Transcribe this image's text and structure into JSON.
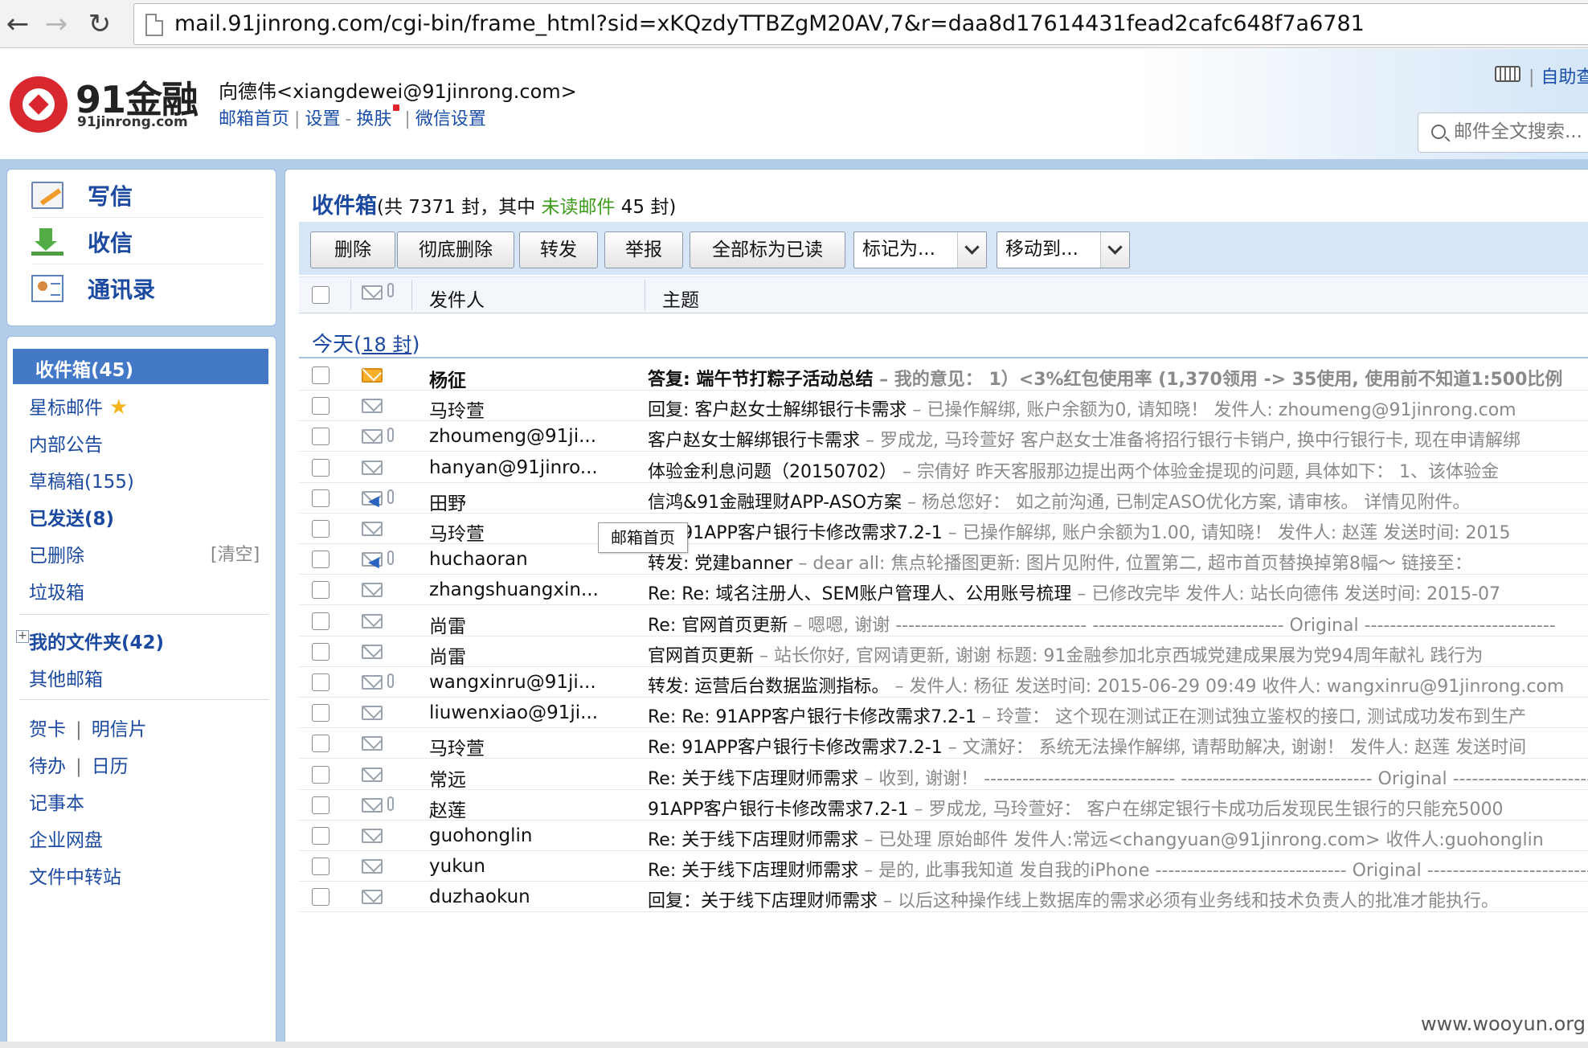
{
  "browser": {
    "back_glyph": "←",
    "forward_glyph": "→",
    "reload_glyph": "↻",
    "url": "mail.91jinrong.com/cgi-bin/frame_html?sid=xKQzdyTTBZgM20AV,7&r=daa8d17614431fead2cafc648f7a6781"
  },
  "header": {
    "logo_text": "91金融",
    "logo_sub": "91jinrong.com",
    "account": "向德伟<xiangdewei@91jinrong.com>",
    "links": [
      "邮箱首页",
      "设置",
      "换肤",
      "微信设置"
    ],
    "link_sep_a": "|",
    "link_dash": "-",
    "help_sep": "|",
    "help_link": "自助查询",
    "search_placeholder": "邮件全文搜索..."
  },
  "sidebar": {
    "top_items": [
      {
        "label": "写信",
        "icon": "write-icon"
      },
      {
        "label": "收信",
        "icon": "receive-icon"
      },
      {
        "label": "通讯录",
        "icon": "contacts-icon"
      }
    ],
    "inbox": "收件箱(45)",
    "starred": "星标邮件",
    "star_glyph": "★",
    "notice": "内部公告",
    "drafts": "草稿箱(155)",
    "sent": "已发送(8)",
    "deleted": "已删除",
    "clear": "[清空]",
    "junk": "垃圾箱",
    "expand_glyph": "+",
    "my_folders": "我的文件夹(42)",
    "other_mail": "其他邮箱",
    "card": "贺卡",
    "postcard": "明信片",
    "todo": "待办",
    "calendar": "日历",
    "notepad": "记事本",
    "netdisk": "企业网盘",
    "transfer": "文件中转站",
    "pipe": "|"
  },
  "main": {
    "title": "收件箱",
    "title_a": "(共 7371 封，其中 ",
    "unread_label": "未读邮件",
    "title_b": " 45 封)",
    "buttons": [
      "删除",
      "彻底删除",
      "转发",
      "举报",
      "全部标为已读"
    ],
    "mark_as": "标记为...",
    "move_to": "移动到...",
    "col_sender": "发件人",
    "col_subject": "主题",
    "group_today": "今天",
    "group_count": "18 封",
    "paren_open": "(",
    "paren_close": ")",
    "tooltip": "邮箱首页",
    "watermark": "www.wooyun.org",
    "emails": [
      {
        "sender": "杨征",
        "subject": "答复: 端午节打粽子活动总结",
        "preview": " – 我的意见： 1）<3%红包使用率 (1,370领用 -> 35使用, 使用前不知道1:500比例",
        "unread": true,
        "clip": false,
        "reply": false
      },
      {
        "sender": "马玲萱",
        "subject": "回复: 客户赵女士解绑银行卡需求",
        "preview": " – 已操作解绑, 账户余额为0, 请知晓！ 发件人: zhoumeng@91jinrong.com",
        "unread": false,
        "clip": false,
        "reply": false
      },
      {
        "sender": "zhoumeng@91ji...",
        "subject": "客户赵女士解绑银行卡需求",
        "preview": " – 罗成龙, 马玲萱好 客户赵女士准备将招行银行卡销户, 换中行银行卡, 现在申请解绑",
        "unread": false,
        "clip": true,
        "reply": false
      },
      {
        "sender": "hanyan@91jinro...",
        "subject": "体验金利息问题（20150702）",
        "preview": " – 宗倩好 昨天客服那边提出两个体验金提现的问题, 具体如下： 1、该体验金",
        "unread": false,
        "clip": false,
        "reply": false
      },
      {
        "sender": "田野",
        "subject": "信鸿&91金融理财APP-ASO方案",
        "preview": " – 杨总您好： 如之前沟通, 已制定ASO优化方案, 请审核。 详情见附件。",
        "unread": false,
        "clip": true,
        "reply": true
      },
      {
        "sender": "马玲萱",
        "subject": "Re: 91APP客户银行卡修改需求7.2-1",
        "preview": " – 已操作解绑, 账户余额为1.00, 请知晓！ 发件人: 赵莲 发送时间: 2015",
        "unread": false,
        "clip": false,
        "reply": false
      },
      {
        "sender": "huchaoran",
        "subject": "转发: 党建banner",
        "preview": " – dear all: 焦点轮播图更新: 图片见附件, 位置第二, 超市首页替换掉第8幅～ 链接至：",
        "unread": false,
        "clip": true,
        "reply": true
      },
      {
        "sender": "zhangshuangxin...",
        "subject": "Re: Re: 域名注册人、SEM账户管理人、公用账号梳理",
        "preview": " – 已修改完毕 发件人: 站长向德伟 发送时间: 2015-07",
        "unread": false,
        "clip": false,
        "reply": false
      },
      {
        "sender": "尚雷",
        "subject": "Re: 官网首页更新",
        "preview": " – 嗯嗯, 谢谢 ------------------------------ ------------------------------ Original ------------------------------",
        "unread": false,
        "clip": false,
        "reply": false
      },
      {
        "sender": "尚雷",
        "subject": "官网首页更新",
        "preview": " – 站长你好, 官网请更新, 谢谢 标题: 91金融参加北京西城党建成果展为党94周年献礼 践行为",
        "unread": false,
        "clip": false,
        "reply": false
      },
      {
        "sender": "wangxinru@91ji...",
        "subject": "转发: 运营后台数据监测指标。",
        "preview": " – 发件人: 杨征 发送时间: 2015-06-29 09:49 收件人: wangxinru@91jinrong.com",
        "unread": false,
        "clip": true,
        "reply": false
      },
      {
        "sender": "liuwenxiao@91ji...",
        "subject": "Re: Re: 91APP客户银行卡修改需求7.2-1",
        "preview": " – 玲萱： 这个现在测试正在测试独立鉴权的接口, 测试成功发布到生产",
        "unread": false,
        "clip": false,
        "reply": false
      },
      {
        "sender": "马玲萱",
        "subject": "Re: 91APP客户银行卡修改需求7.2-1",
        "preview": " – 文潇好： 系统无法操作解绑, 请帮助解决, 谢谢！ 发件人: 赵莲 发送时间",
        "unread": false,
        "clip": false,
        "reply": false
      },
      {
        "sender": "常远",
        "subject": "Re: 关于线下店理财师需求",
        "preview": " – 收到, 谢谢！ ------------------------------ ------------------------------ Original ------------------------------",
        "unread": false,
        "clip": false,
        "reply": false
      },
      {
        "sender": "赵莲",
        "subject": "91APP客户银行卡修改需求7.2-1",
        "preview": " – 罗成龙, 马玲萱好： 客户在绑定银行卡成功后发现民生银行的只能充5000",
        "unread": false,
        "clip": true,
        "reply": false
      },
      {
        "sender": "guohonglin",
        "subject": "Re: 关于线下店理财师需求",
        "preview": " – 已处理 原始邮件 发件人:常远<changyuan@91jinrong.com> 收件人:guohonglin",
        "unread": false,
        "clip": false,
        "reply": false
      },
      {
        "sender": "yukun",
        "subject": "Re: 关于线下店理财师需求",
        "preview": " – 是的, 此事我知道 发自我的iPhone ------------------------------ Original ------------------------------",
        "unread": false,
        "clip": false,
        "reply": false
      },
      {
        "sender": "duzhaokun",
        "subject": "回复：关于线下店理财师需求",
        "preview": " – 以后这种操作线上数据库的需求必须有业务线和技术负责人的批准才能执行。",
        "unread": false,
        "clip": false,
        "reply": false
      }
    ]
  }
}
